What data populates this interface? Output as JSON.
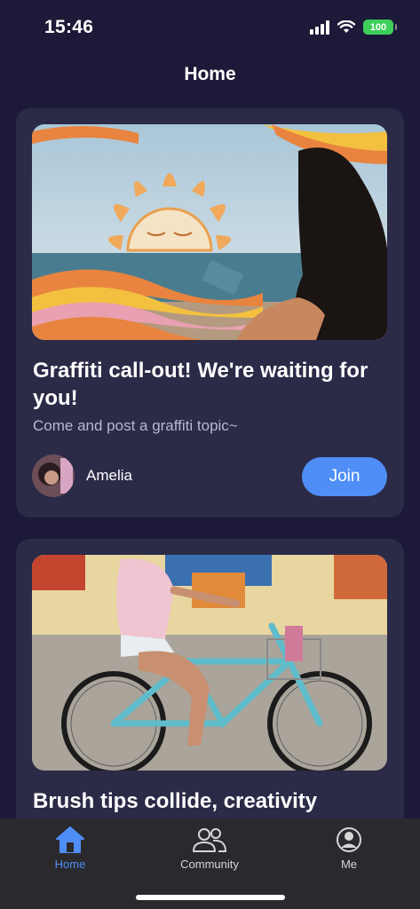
{
  "status_bar": {
    "time": "15:46",
    "battery": "100"
  },
  "header": {
    "title": "Home"
  },
  "cards": [
    {
      "title": "Graffiti call-out! We're waiting for you!",
      "description": "Come and post a graffiti topic~",
      "author": "Amelia",
      "button": "Join"
    },
    {
      "title": "Brush tips collide, creativity"
    }
  ],
  "tabs": [
    {
      "label": "Home",
      "icon": "home-icon",
      "active": true
    },
    {
      "label": "Community",
      "icon": "community-icon",
      "active": false
    },
    {
      "label": "Me",
      "icon": "profile-icon",
      "active": false
    }
  ],
  "colors": {
    "background": "#1c1a38",
    "card": "#2b2a47",
    "accent": "#4f8ef7",
    "tab_bar": "#2a2a2e"
  }
}
